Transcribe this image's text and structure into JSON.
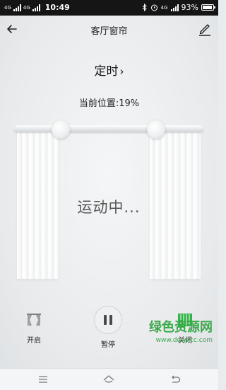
{
  "status_bar": {
    "network_left": "4G",
    "network_left2": "4G",
    "time": "10:49",
    "network_right": "4G",
    "battery_text": "93%",
    "battery_level": 0.93
  },
  "header": {
    "title": "客厅窗帘",
    "back_icon": "back-arrow-icon",
    "edit_icon": "edit-pen-icon"
  },
  "timer": {
    "label": "定时",
    "chevron": "›"
  },
  "position": {
    "text": "当前位置:19%",
    "value_percent": 19
  },
  "curtain": {
    "status_text": "运动中..."
  },
  "controls": {
    "open_label": "开启",
    "pause_label": "暂停",
    "close_label": "关闭",
    "accent_color": "#32b34a"
  },
  "watermark": {
    "text": "绿色资源网",
    "url": "www.downcc.com"
  }
}
